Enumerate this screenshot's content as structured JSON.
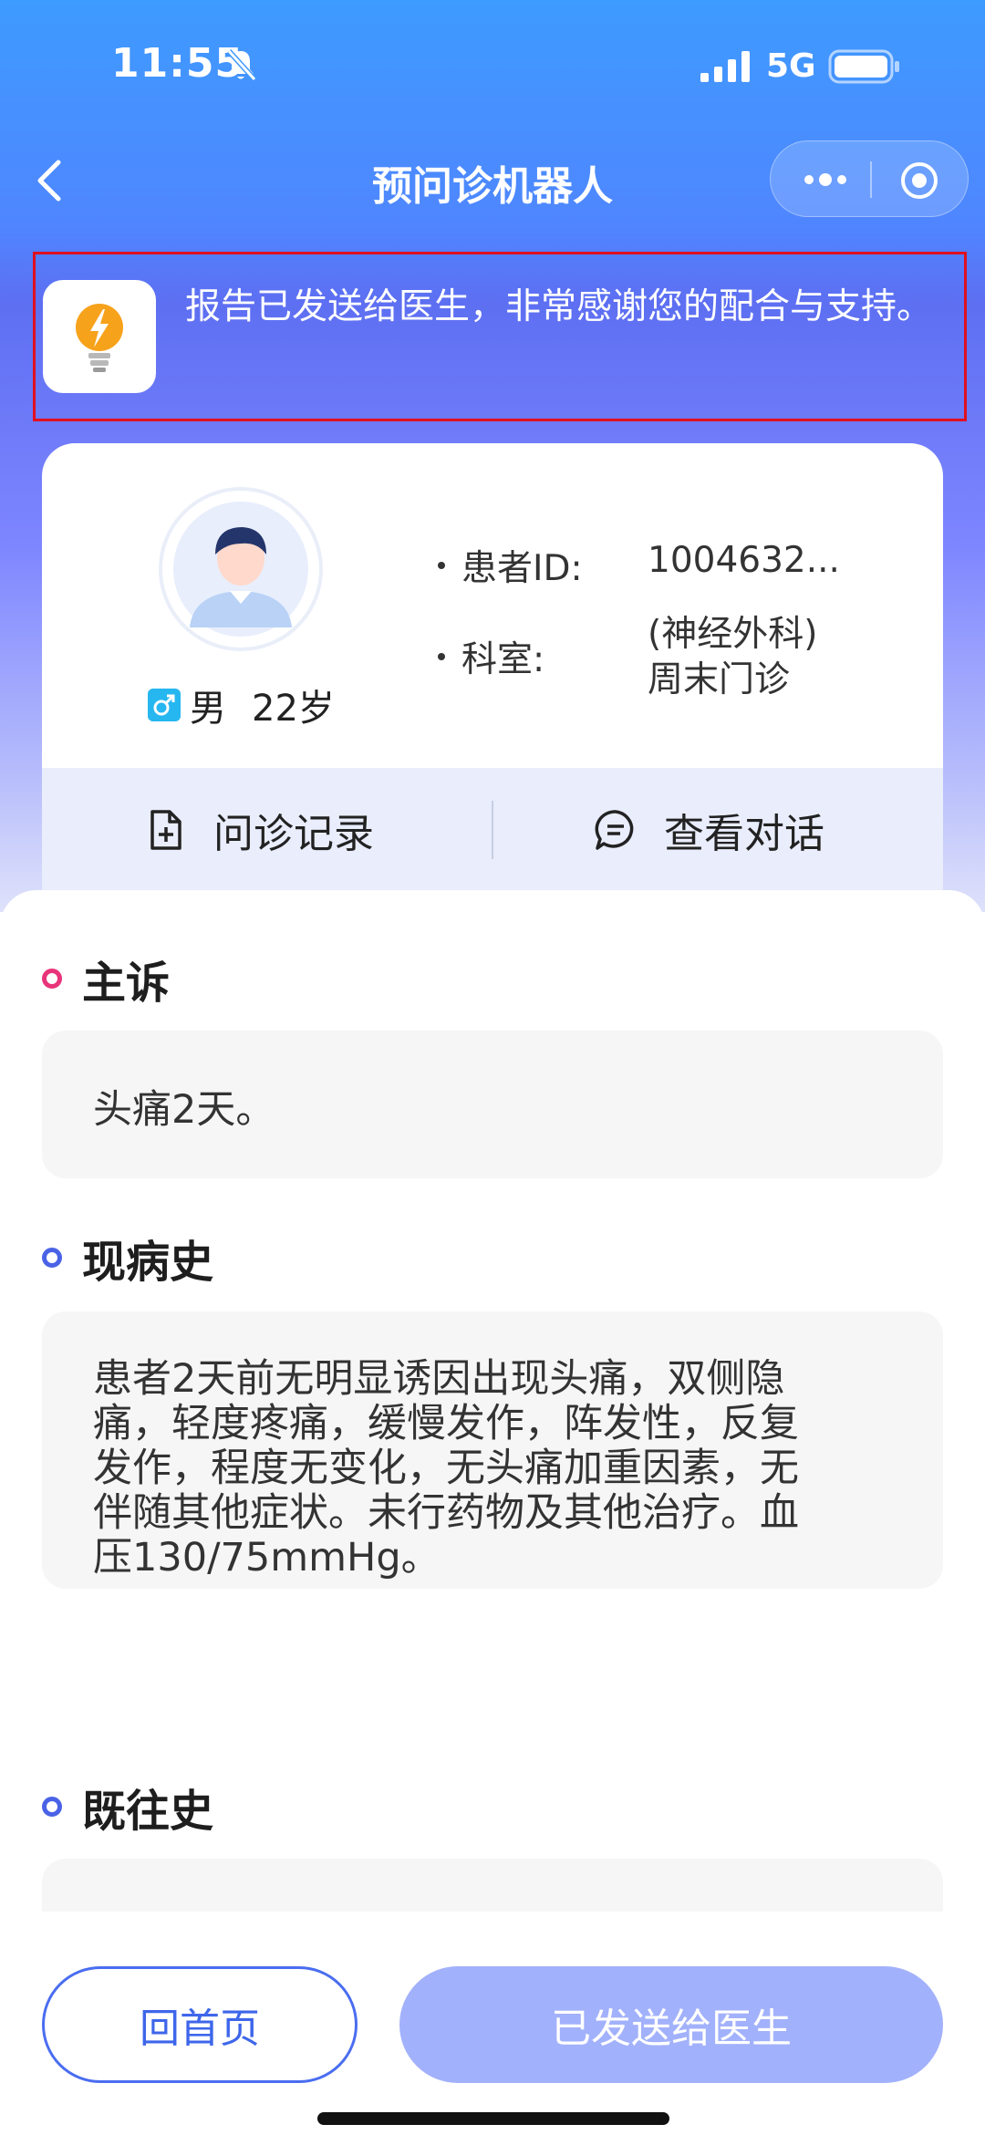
{
  "status_bar": {
    "time": "11:55",
    "network": "5G"
  },
  "nav": {
    "title": "预问诊机器人"
  },
  "notice": {
    "text": "报告已发送给医生，非常感谢您的配合与支持。"
  },
  "patient": {
    "gender": "男",
    "age": "22岁",
    "id_label": "患者ID:",
    "id_value": "1004632...",
    "dept_label": "科室:",
    "dept_value_line1": "(神经外科)",
    "dept_value_line2": "周末门诊"
  },
  "tabs": [
    {
      "label": "问诊记录",
      "icon": "file-add-icon"
    },
    {
      "label": "查看对话",
      "icon": "chat-icon"
    }
  ],
  "sections": [
    {
      "title": "主诉",
      "dot_color": "#e8347a",
      "text": "头痛2天。"
    },
    {
      "title": "现病史",
      "dot_color": "#4a63e6",
      "lines": [
        "患者2天前无明显诱因出现头痛，双侧隐",
        "痛，轻度疼痛，缓慢发作，阵发性，反复",
        "发作，程度无变化，无头痛加重因素，无",
        "伴随其他症状。未行药物及其他治疗。血",
        "压130/75mmHg。"
      ]
    },
    {
      "title": "既往史",
      "dot_color": "#4a63e6",
      "text": ""
    }
  ],
  "footer": {
    "home_label": "回首页",
    "sent_label": "已发送给医生"
  },
  "colors": {
    "primary": "#4a6df0",
    "header_blue": "#3e9bff",
    "notice_border": "#e01020",
    "sent_button": "#a2b1fb"
  }
}
